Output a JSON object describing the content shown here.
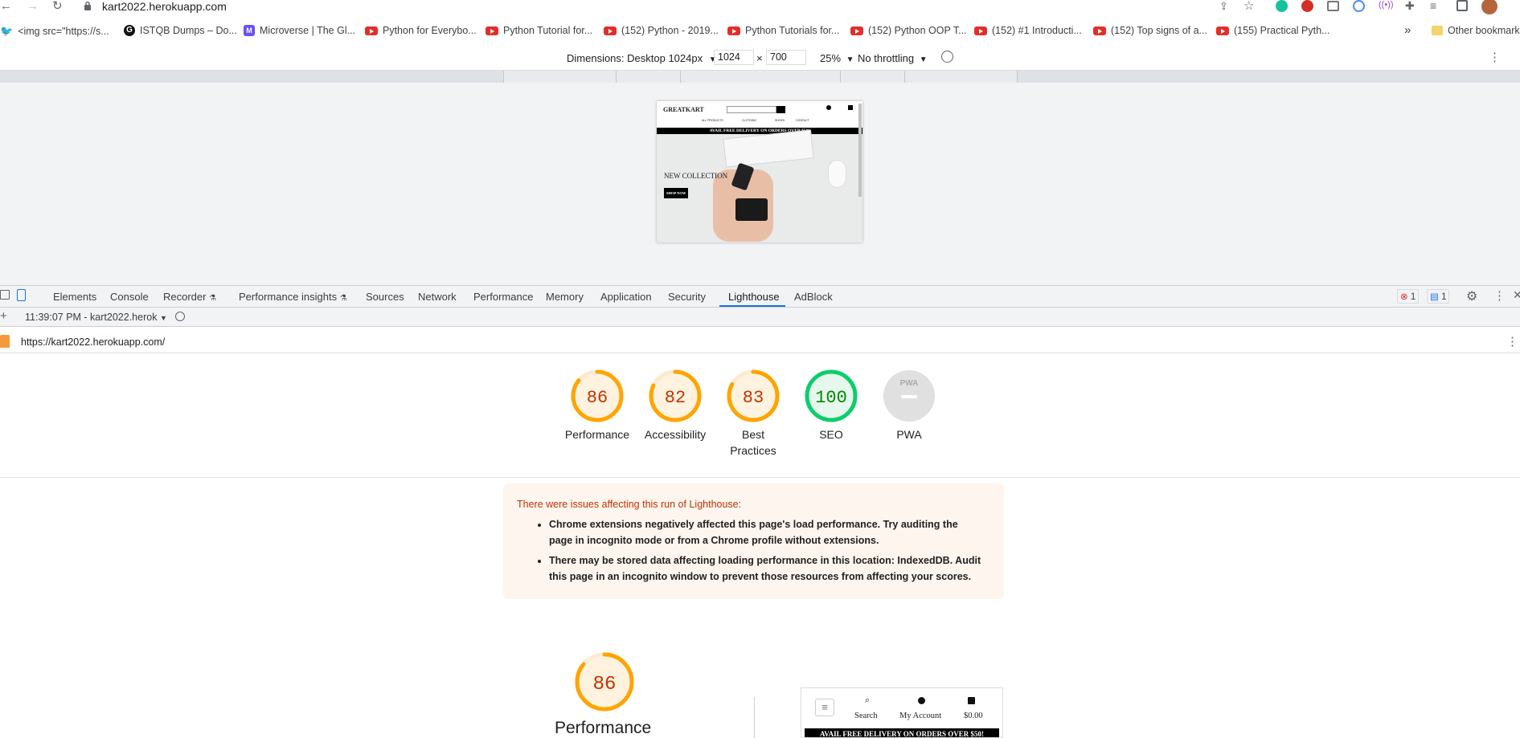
{
  "browser": {
    "url": "kart2022.herokuapp.com",
    "bookmarks": [
      {
        "label": "<img src=\"https://s...",
        "icon": "bird-icon"
      },
      {
        "label": "ISTQB Dumps – Do...",
        "icon": "g-icon"
      },
      {
        "label": "Microverse | The Gl...",
        "icon": "microverse-icon"
      },
      {
        "label": "Python for Everybo...",
        "icon": "youtube-icon"
      },
      {
        "label": "Python Tutorial for...",
        "icon": "youtube-icon"
      },
      {
        "label": "(152) Python - 2019...",
        "icon": "youtube-icon"
      },
      {
        "label": "Python Tutorials for...",
        "icon": "youtube-icon"
      },
      {
        "label": "(152) Python OOP T...",
        "icon": "youtube-icon"
      },
      {
        "label": "(152) #1 Introducti...",
        "icon": "youtube-icon"
      },
      {
        "label": "(152) Top signs of a...",
        "icon": "youtube-icon"
      },
      {
        "label": "(155) Practical Pyth...",
        "icon": "youtube-icon"
      }
    ],
    "more_bookmarks": "»",
    "other_bookmarks": "Other bookmarks"
  },
  "device_toolbar": {
    "dimensions_label": "Dimensions: Desktop 1024px",
    "width": "1024",
    "times": "×",
    "height": "700",
    "zoom": "25%",
    "throttling": "No throttling"
  },
  "preview": {
    "brand": "GREATKART",
    "nav": [
      "ALL PRODUCTS",
      "CLOTHING",
      "SHOES",
      "CONTACT"
    ],
    "banner": "AVAIL FREE DELIVERY ON ORDERS OVER $50!",
    "hero_title": "NEW COLLECTION",
    "hero_button": "SHOP NOW"
  },
  "devtools": {
    "tabs": [
      "Elements",
      "Console",
      "Recorder",
      "Performance insights",
      "Sources",
      "Network",
      "Performance",
      "Memory",
      "Application",
      "Security",
      "Lighthouse",
      "AdBlock"
    ],
    "active_tab": "Lighthouse",
    "error_count": "1",
    "message_count": "1",
    "report_select": "11:39:07 PM - kart2022.herok",
    "report_url": "https://kart2022.herokuapp.com/"
  },
  "scores": [
    {
      "value": "86",
      "label": "Performance",
      "color": "#ffa400",
      "text_color": "#c33300",
      "fraction": 0.86
    },
    {
      "value": "82",
      "label": "Accessibility",
      "color": "#ffa400",
      "text_color": "#c33300",
      "fraction": 0.82
    },
    {
      "value": "83",
      "label": "Best Practices",
      "color": "#ffa400",
      "text_color": "#c33300",
      "fraction": 0.83
    },
    {
      "value": "100",
      "label": "SEO",
      "color": "#0cce6b",
      "text_color": "#008800",
      "fraction": 1.0
    },
    {
      "value": "PWA",
      "label": "PWA",
      "color": "#e0e0e0",
      "text_color": "#9e9e9e",
      "fraction": 0
    }
  ],
  "warning": {
    "title": "There were issues affecting this run of Lighthouse:",
    "items": [
      "Chrome extensions negatively affected this page's load performance. Try auditing the page in incognito mode or from a Chrome profile without extensions.",
      "There may be stored data affecting loading performance in this location: IndexedDB. Audit this page in an incognito window to prevent those resources from affecting your scores."
    ]
  },
  "perf_section": {
    "score": "86",
    "label": "Performance"
  },
  "mobile_preview": {
    "search": "Search",
    "account": "My Account",
    "cart": "$0.00",
    "banner": "AVAIL FREE DELIVERY ON ORDERS OVER $50!"
  }
}
